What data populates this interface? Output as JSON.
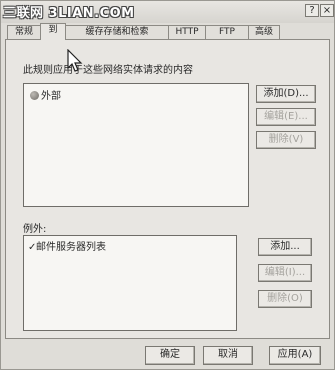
{
  "window": {
    "watermark": "三联网 3LIAN.COM",
    "help_label": "?",
    "close_label": "×"
  },
  "tabs": [
    {
      "label": "常规"
    },
    {
      "label": "到"
    },
    {
      "label": "缓存存储和检索"
    },
    {
      "label": "HTTP"
    },
    {
      "label": "FTP"
    },
    {
      "label": "高级"
    }
  ],
  "rule": {
    "description": "此规则应用于这些网络实体请求的内容",
    "destinations": [
      "外部"
    ],
    "add_label": "添加(D)...",
    "edit_label": "编辑(E)...",
    "remove_label": "删除(V)"
  },
  "exceptions": {
    "label": "例外:",
    "items": [
      "邮件服务器列表"
    ],
    "add_label": "添加...",
    "edit_label": "编辑(I)...",
    "remove_label": "删除(O)"
  },
  "footer": {
    "ok_label": "确定",
    "cancel_label": "取消",
    "apply_label": "应用(A)"
  }
}
